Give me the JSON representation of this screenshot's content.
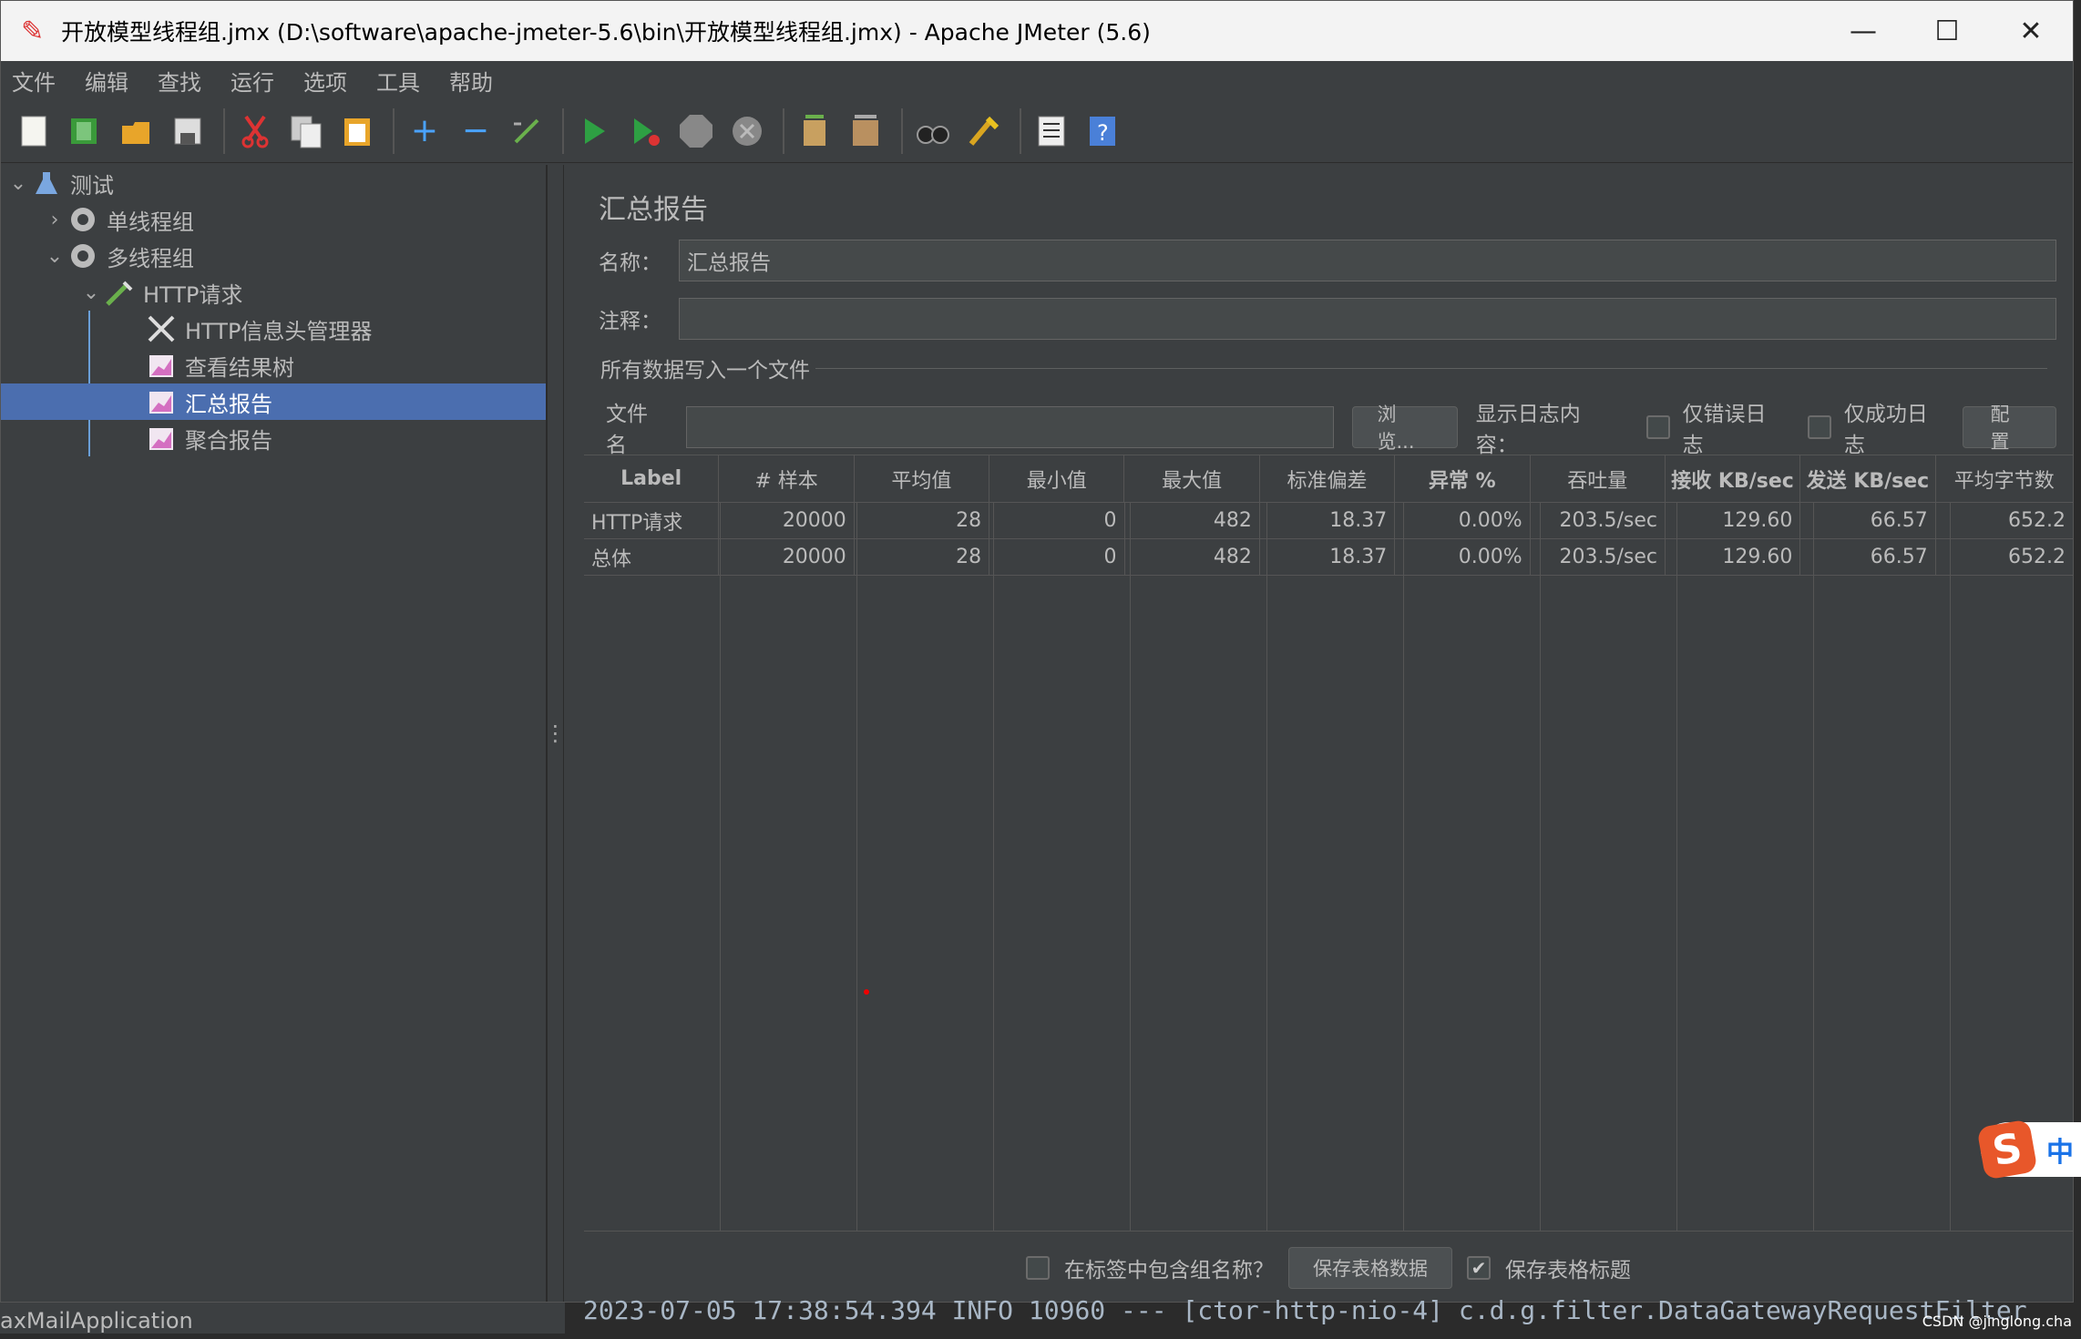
{
  "window": {
    "title": "开放模型线程组.jmx (D:\\software\\apache-jmeter-5.6\\bin\\开放模型线程组.jmx) - Apache JMeter (5.6)",
    "minimize": "—",
    "maximize": "☐",
    "close": "✕"
  },
  "menu": [
    "文件",
    "编辑",
    "查找",
    "运行",
    "选项",
    "工具",
    "帮助"
  ],
  "tree": {
    "root": "测试",
    "items": [
      {
        "label": "单线程组",
        "icon": "gear-icon"
      },
      {
        "label": "多线程组",
        "icon": "gear-icon"
      },
      {
        "label": "HTTP请求",
        "icon": "pipette-icon"
      },
      {
        "label": "HTTP信息头管理器",
        "icon": "tools-icon"
      },
      {
        "label": "查看结果树",
        "icon": "graph-icon"
      },
      {
        "label": "汇总报告",
        "icon": "graph-icon"
      },
      {
        "label": "聚合报告",
        "icon": "graph-icon"
      }
    ],
    "selected": "汇总报告"
  },
  "panel": {
    "title": "汇总报告",
    "name_label": "名称：",
    "name_value": "汇总报告",
    "comment_label": "注释：",
    "comment_value": "",
    "group_title": "所有数据写入一个文件",
    "file_label": "文件名",
    "browse": "浏览...",
    "log_label": "显示日志内容：",
    "errors_only": "仅错误日志",
    "success_only": "仅成功日志",
    "configure": "配置"
  },
  "table": {
    "headers": [
      "Label",
      "# 样本",
      "平均值",
      "最小值",
      "最大值",
      "标准偏差",
      "异常 %",
      "吞吐量",
      "接收 KB/sec",
      "发送 KB/sec",
      "平均字节数"
    ],
    "rows": [
      [
        "HTTP请求",
        "20000",
        "28",
        "0",
        "482",
        "18.37",
        "0.00%",
        "203.5/sec",
        "129.60",
        "66.57",
        "652.2"
      ],
      [
        "总体",
        "20000",
        "28",
        "0",
        "482",
        "18.37",
        "0.00%",
        "203.5/sec",
        "129.60",
        "66.57",
        "652.2"
      ]
    ]
  },
  "footer": {
    "include_group": "在标签中包含组名称？",
    "save_table": "保存表格数据",
    "save_header": "保存表格标题",
    "save_header_checked": "✔"
  },
  "background": {
    "app": "axMailApplication",
    "log": "2023-07-05 17:38:54.394  INFO 10960 --- [ctor-http-nio-4] c.d.g.filter.DataGatewayRequestFilter",
    "watermark": "CSDN @jinglong.cha"
  },
  "ime": {
    "logo": "S",
    "mode": "中"
  }
}
